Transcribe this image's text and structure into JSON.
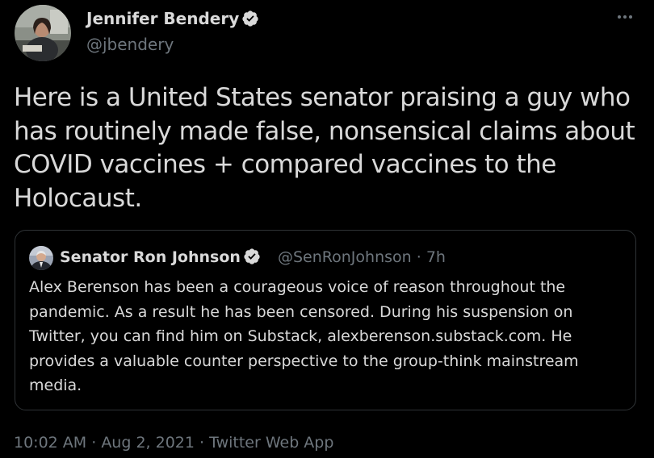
{
  "author": {
    "name": "Jennifer Bendery",
    "handle": "@jbendery",
    "verified_icon": "verified-badge-icon"
  },
  "tweet": {
    "text": "Here is a United States senator praising a guy who\nhas routinely made false, nonsensical claims about\nCOVID vaccines + compared vaccines to the\nHolocaust."
  },
  "quote": {
    "name": "Senator Ron Johnson",
    "handle": "@SenRonJohnson",
    "separator": " · ",
    "time": "7h",
    "text": "Alex Berenson has been a courageous voice of reason throughout the\npandemic. As a result he has been censored. During his suspension on\nTwitter, you can find him on Substack, alexberenson.substack.com. He\nprovides a valuable counter perspective to the group-think mainstream\nmedia."
  },
  "meta": {
    "time": "10:02 AM",
    "sep1": " · ",
    "date": "Aug 2, 2021",
    "sep2": " · ",
    "source": "Twitter Web App"
  },
  "colors": {
    "background": "#000000",
    "text": "#d9d9d9",
    "secondary": "#6e767d",
    "border": "#2f3336"
  },
  "icons": {
    "more": "more-options-icon",
    "verified": "verified-badge-icon"
  }
}
